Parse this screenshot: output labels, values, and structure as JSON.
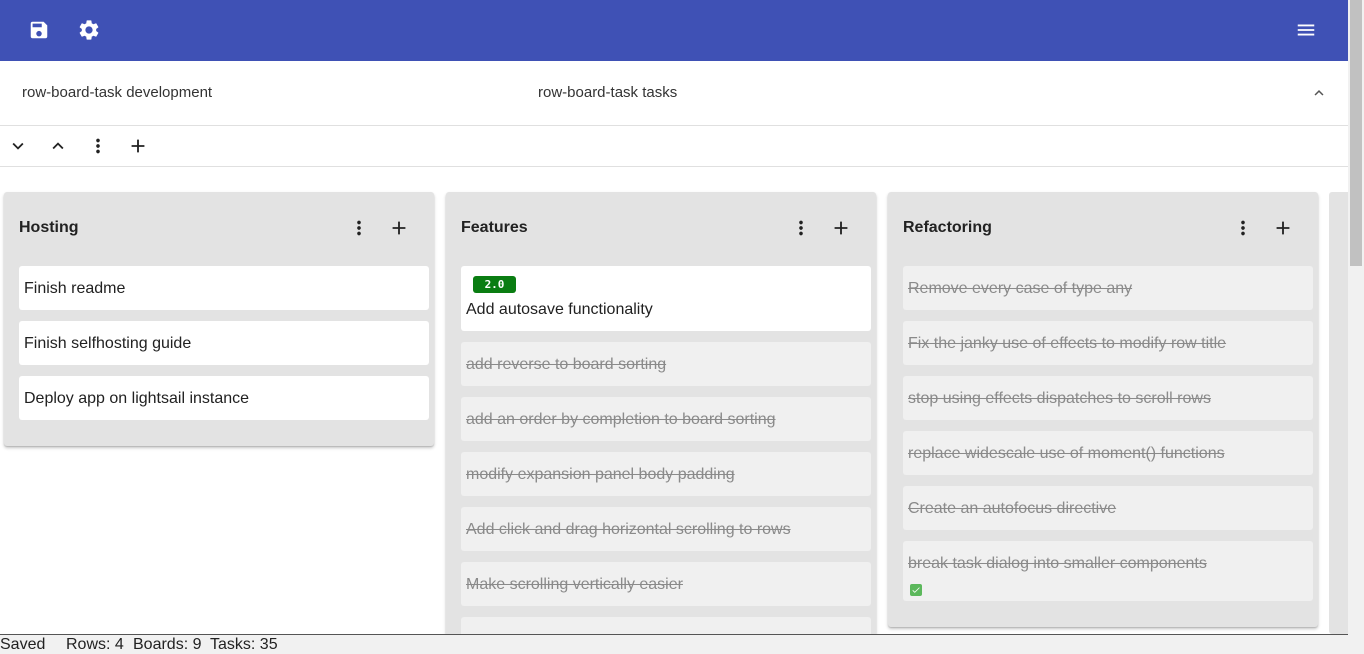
{
  "toolbar": {
    "background": "#3f51b5",
    "icons": [
      "save-icon",
      "gear-icon",
      "menu-icon"
    ]
  },
  "row": {
    "title": "row-board-task development",
    "subtitle": "row-board-task tasks"
  },
  "boards": [
    {
      "title": "Hosting",
      "tasks": [
        {
          "text": "Finish readme",
          "completed": false
        },
        {
          "text": "Finish selfhosting guide",
          "completed": false
        },
        {
          "text": "Deploy app on lightsail instance",
          "completed": false
        }
      ]
    },
    {
      "title": "Features",
      "tasks": [
        {
          "text": "Add autosave functionality",
          "completed": false,
          "tag": "2.0",
          "tag_color": "#0a7d12"
        },
        {
          "text": "add reverse to board sorting",
          "completed": true
        },
        {
          "text": "add an order by completion to board sorting",
          "completed": true
        },
        {
          "text": "modify expansion panel body padding",
          "completed": true
        },
        {
          "text": "Add click and drag horizontal scrolling to rows",
          "completed": true
        },
        {
          "text": "Make scrolling vertically easier",
          "completed": true
        }
      ]
    },
    {
      "title": "Refactoring",
      "tasks": [
        {
          "text": "Remove every case of type any",
          "completed": true
        },
        {
          "text": "Fix the janky use of effects to modify row title",
          "completed": true
        },
        {
          "text": "stop using effects dispatches to scroll rows",
          "completed": true
        },
        {
          "text": "replace widescale use of moment() functions",
          "completed": true
        },
        {
          "text": "Create an autofocus directive",
          "completed": true
        },
        {
          "text": "break task dialog into smaller components",
          "completed": true,
          "checklist_complete": true
        }
      ]
    }
  ],
  "status": {
    "save_state": "Saved",
    "rows": "Rows: 4",
    "boards": "Boards: 9",
    "tasks": "Tasks: 35"
  }
}
